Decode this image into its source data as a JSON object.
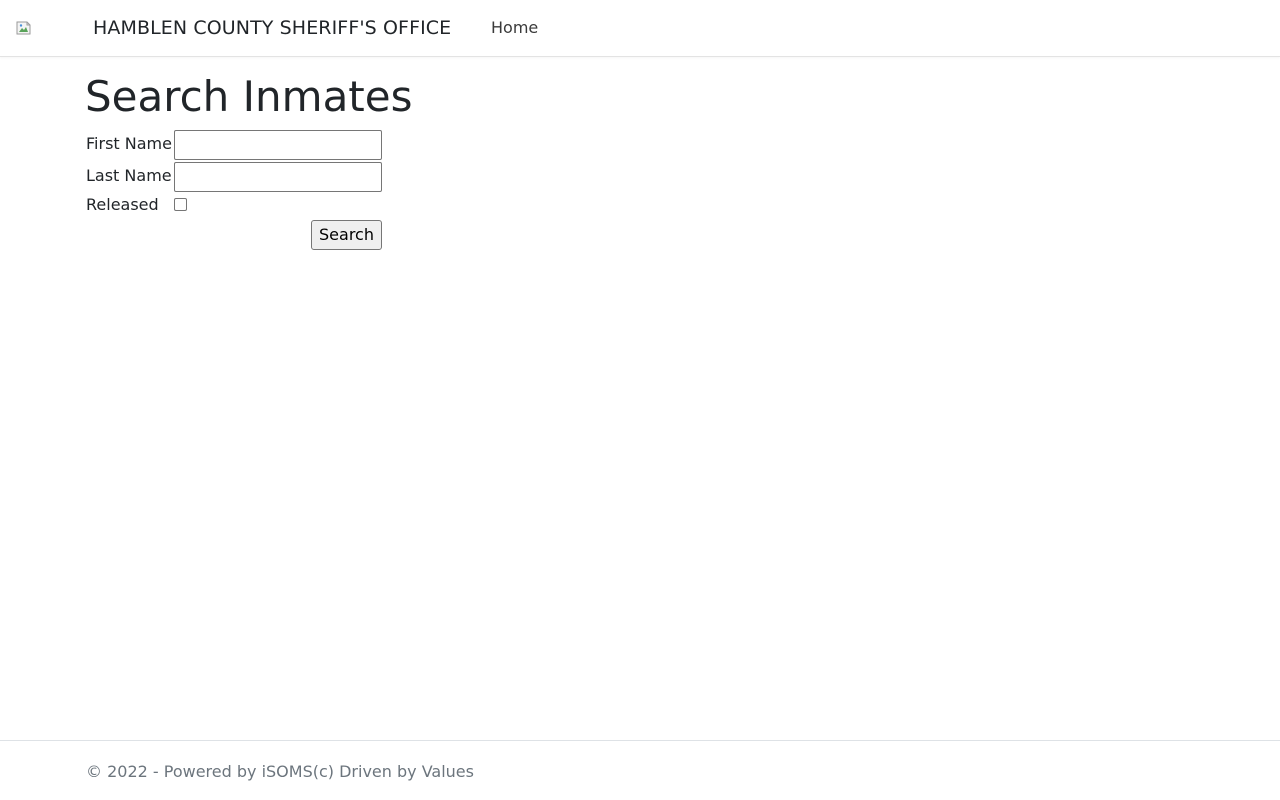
{
  "header": {
    "brand": "HAMBLEN COUNTY SHERIFF'S OFFICE",
    "nav": [
      {
        "label": "Home"
      }
    ],
    "logo_icon": "broken-image-icon"
  },
  "main": {
    "title": "Search Inmates",
    "form": {
      "first_name_label": "First Name",
      "first_name_value": "",
      "last_name_label": "Last Name",
      "last_name_value": "",
      "released_label": "Released",
      "released_checked": false,
      "search_label": "Search"
    }
  },
  "footer": {
    "text": "© 2022 - Powered by iSOMS(c) Driven by Values"
  }
}
